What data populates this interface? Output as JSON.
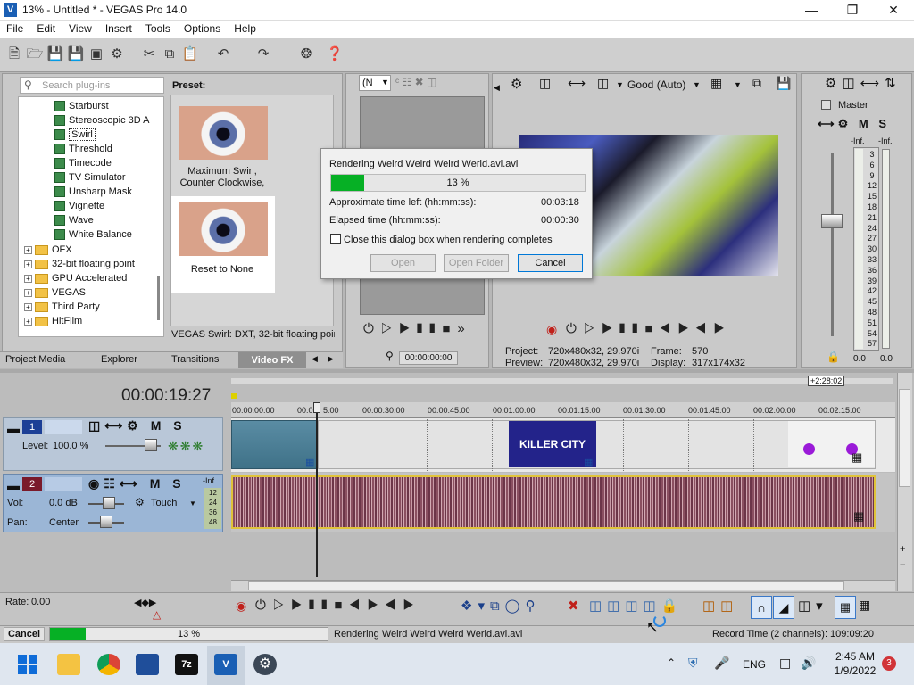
{
  "window": {
    "title": "13% - Untitled * - VEGAS Pro 14.0",
    "logo": "V"
  },
  "menu": [
    "File",
    "Edit",
    "View",
    "Insert",
    "Tools",
    "Options",
    "Help"
  ],
  "plugins": {
    "search_placeholder": "Search plug-ins",
    "fx_items": [
      "Starburst",
      "Stereoscopic 3D A",
      "Swirl",
      "Threshold",
      "Timecode",
      "TV Simulator",
      "Unsharp Mask",
      "Vignette",
      "Wave",
      "White Balance"
    ],
    "folders": [
      "OFX",
      "32-bit floating point",
      "GPU Accelerated",
      "VEGAS",
      "Third Party",
      "HitFilm"
    ],
    "selected": "Swirl"
  },
  "preset": {
    "header": "Preset:",
    "items": [
      "Maximum Swirl, Counter Clockwise,",
      "Reset to None"
    ],
    "status": "VEGAS Swirl: DXT, 32-bit floating poin"
  },
  "tabs": [
    "Project Media",
    "Explorer",
    "Transitions",
    "Video FX"
  ],
  "trimmer": {
    "dropdown": "(N",
    "timecode": "00:00:00:00"
  },
  "preview": {
    "quality": "Good (Auto)",
    "project_label": "Project:",
    "project_value": "720x480x32, 29.970i",
    "preview_label": "Preview:",
    "preview_value": "720x480x32, 29.970i",
    "frame_label": "Frame:",
    "frame_value": "570",
    "display_label": "Display:",
    "display_value": "317x174x32"
  },
  "master": {
    "label": "Master",
    "inf_left": "-Inf.",
    "inf_right": "-Inf.",
    "scale": [
      "3",
      "6",
      "9",
      "12",
      "15",
      "18",
      "21",
      "24",
      "27",
      "30",
      "33",
      "36",
      "39",
      "42",
      "45",
      "48",
      "51",
      "54",
      "57"
    ],
    "bottom_left": "0.0",
    "bottom_right": "0.0"
  },
  "render_dialog": {
    "title": "Rendering Weird Weird Weird Werid.avi.avi",
    "progress_label": "13 %",
    "progress": 0.13,
    "time_left_label": "Approximate time left (hh:mm:ss):",
    "time_left": "00:03:18",
    "elapsed_label": "Elapsed time (hh:mm:ss):",
    "elapsed": "00:00:30",
    "close_checkbox_label": "Close this dialog box when rendering completes",
    "open_label": "Open",
    "open_folder_label": "Open Folder",
    "cancel_label": "Cancel"
  },
  "timeline": {
    "cursor_time": "00:00:19:27",
    "end_marker": "+2:28:02",
    "ruler": [
      "00:00:00:00",
      "00:0",
      "5:00",
      "00:00:30:00",
      "00:00:45:00",
      "00:01:00:00",
      "00:01:15:00",
      "00:01:30:00",
      "00:01:45:00",
      "00:02:00:00",
      "00:02:15:00"
    ],
    "track1": {
      "num": "1",
      "level_label": "Level:",
      "level": "100.0 %"
    },
    "track2": {
      "num": "2",
      "vol_label": "Vol:",
      "vol": "0.0 dB",
      "pan_label": "Pan:",
      "pan": "Center",
      "mode": "Touch",
      "meter_top": "-Inf.",
      "meter": [
        "12",
        "24",
        "36",
        "48"
      ]
    },
    "clip_text": "KILLER CITY"
  },
  "transport": {
    "rate_label": "Rate:",
    "rate": "0.00"
  },
  "statusbar": {
    "cancel_label": "Cancel",
    "progress_label": "13 %",
    "progress": 0.13,
    "message": "Rendering Weird Weird Weird Werid.avi.avi",
    "record_time": "Record Time (2 channels): 109:09:20"
  },
  "taskbar": {
    "lang": "ENG",
    "time": "2:45 AM",
    "date": "1/9/2022",
    "notif": "3"
  }
}
